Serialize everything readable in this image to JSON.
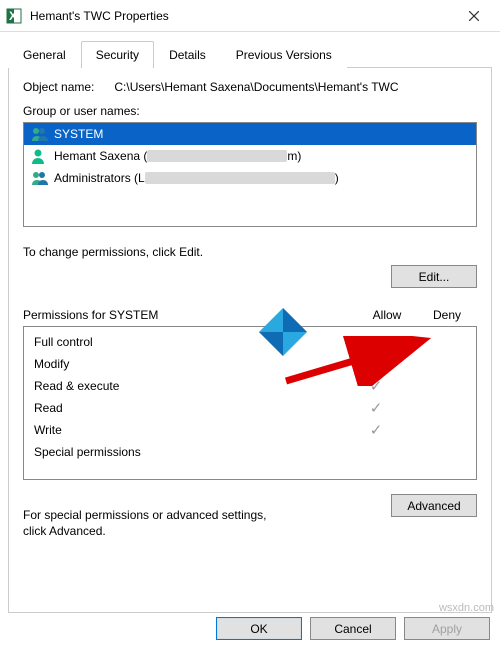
{
  "window": {
    "title": "Hemant's TWC                         Properties"
  },
  "tabs": {
    "general": "General",
    "security": "Security",
    "details": "Details",
    "previous": "Previous Versions",
    "active": "security"
  },
  "object": {
    "label": "Object name:",
    "path": "C:\\Users\\Hemant Saxena\\Documents\\Hemant's TWC"
  },
  "groups": {
    "label": "Group or user names:",
    "items": [
      {
        "name": "SYSTEM",
        "selected": true,
        "icon": "group-icon"
      },
      {
        "name": "Hemant Saxena (",
        "redacted_w": 140,
        "suffix": "m)",
        "icon": "user-icon"
      },
      {
        "name": "Administrators (L",
        "redacted_w": 190,
        "suffix": ")",
        "icon": "group-icon"
      }
    ]
  },
  "edit": {
    "instruction": "To change permissions, click Edit.",
    "button": "Edit..."
  },
  "permissions": {
    "header": "Permissions for SYSTEM",
    "allow": "Allow",
    "deny": "Deny",
    "rows": [
      {
        "name": "Full control",
        "allow": true,
        "deny": false
      },
      {
        "name": "Modify",
        "allow": true,
        "deny": false
      },
      {
        "name": "Read & execute",
        "allow": true,
        "deny": false
      },
      {
        "name": "Read",
        "allow": true,
        "deny": false
      },
      {
        "name": "Write",
        "allow": true,
        "deny": false
      },
      {
        "name": "Special permissions",
        "allow": false,
        "deny": false
      }
    ]
  },
  "advanced": {
    "text": "For special permissions or advanced settings, click Advanced.",
    "button": "Advanced"
  },
  "buttons": {
    "ok": "OK",
    "cancel": "Cancel",
    "apply": "Apply"
  },
  "watermark": "wsxdn.com"
}
